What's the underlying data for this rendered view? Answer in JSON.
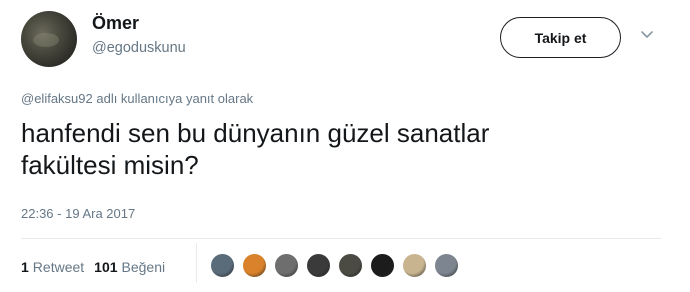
{
  "user": {
    "display_name": "Ömer",
    "handle": "@egoduskunu"
  },
  "actions": {
    "follow_label": "Takip et"
  },
  "reply": {
    "mention": "@elifaksu92",
    "context_text": " adlı kullanıcıya yanıt olarak"
  },
  "tweet": {
    "text_line1": "hanfendi sen bu dünyanın güzel sanatlar",
    "text_line2": "fakültesi misin?",
    "timestamp": "22:36 - 19 Ara 2017"
  },
  "stats": {
    "retweet_count": "1",
    "retweet_label": "Retweet",
    "like_count": "101",
    "like_label": "Beğeni"
  },
  "likers": [
    {
      "color": "#5a6b7a"
    },
    {
      "color": "#d9822b"
    },
    {
      "color": "#6e6e6e"
    },
    {
      "color": "#3a3a3a"
    },
    {
      "color": "#4b4b44"
    },
    {
      "color": "#1c1c1c"
    },
    {
      "color": "#c8b48f"
    },
    {
      "color": "#7d8690"
    }
  ],
  "colors": {
    "text": "#14171a",
    "secondary": "#657786",
    "divider": "#e6ecf0"
  }
}
